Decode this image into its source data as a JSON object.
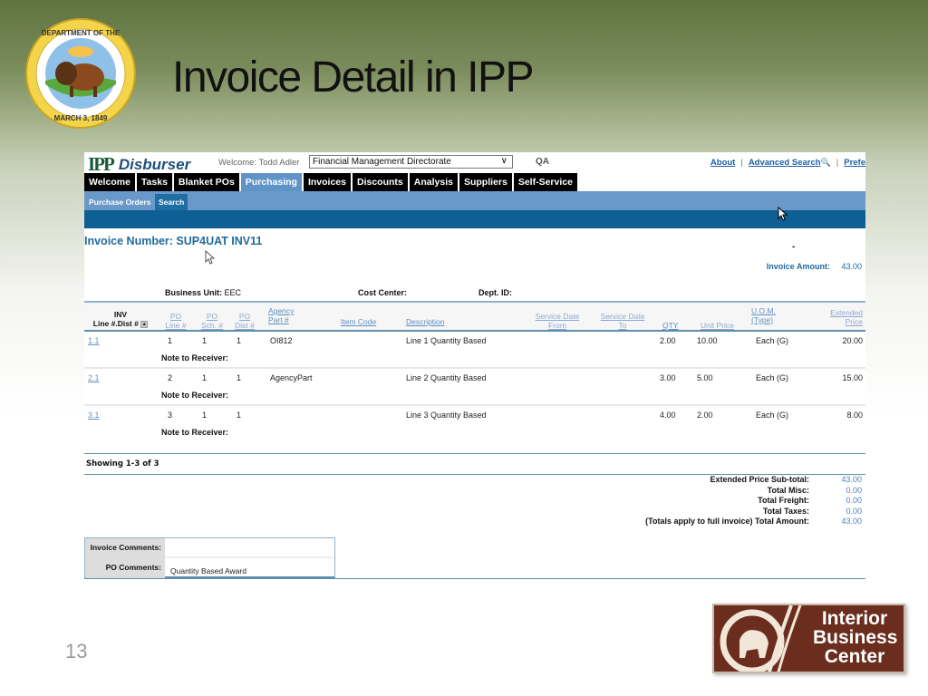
{
  "slide": {
    "title": "Invoice Detail in IPP",
    "page_number": "13",
    "seal_alt": "U.S. Department of the Interior seal — March 3, 1849",
    "logo_lines": [
      "Interior",
      "Business",
      "Center"
    ]
  },
  "app": {
    "brand_ipp": "IPP",
    "brand_name": "Disburser",
    "welcome": "Welcome: Todd Adler",
    "org_select": {
      "value": "Financial Management Directorate"
    },
    "environment": "QA",
    "top_links": [
      {
        "label": "About"
      },
      {
        "label": "Advanced Search"
      },
      {
        "label": "Prefe"
      }
    ],
    "nav_tabs": [
      {
        "label": "Welcome",
        "active": false
      },
      {
        "label": "Tasks",
        "active": false
      },
      {
        "label": "Blanket POs",
        "active": false
      },
      {
        "label": "Purchasing",
        "active": true
      },
      {
        "label": "Invoices",
        "active": false
      },
      {
        "label": "Discounts",
        "active": false
      },
      {
        "label": "Analysis",
        "active": false
      },
      {
        "label": "Suppliers",
        "active": false
      },
      {
        "label": "Self-Service",
        "active": false
      }
    ],
    "sub_tabs": [
      {
        "label": "Purchase Orders",
        "active": false
      },
      {
        "label": "Search",
        "active": true
      }
    ]
  },
  "invoice": {
    "title": "Invoice Number: SUP4UAT INV11",
    "dash": "-",
    "amount_label": "Invoice Amount:",
    "amount_value": "43.00",
    "business_unit_label": "Business Unit:",
    "business_unit_value": "EEC",
    "cost_center_label": "Cost Center:",
    "cost_center_value": "",
    "dept_id_label": "Dept. ID:",
    "dept_id_value": ""
  },
  "table": {
    "headers": {
      "inv_line": [
        "INV",
        "Line #.Dist #"
      ],
      "po_line": [
        "PO",
        "Line #"
      ],
      "po_sch": [
        "PO",
        "Sch. #"
      ],
      "po_dist": [
        "PO",
        "Dist #"
      ],
      "agency_part": [
        "Agency",
        "Part #"
      ],
      "item_code": "Item Code",
      "description": "Description",
      "service_from": [
        "Service Date",
        "From"
      ],
      "service_to": [
        "Service Date",
        "To"
      ],
      "qty": "QTY",
      "unit_price": "Unit Price",
      "uom": [
        "U.O.M.",
        "(Type)"
      ],
      "extended_price": [
        "Extended",
        "Price"
      ]
    },
    "note_label": "Note to Receiver:",
    "rows": [
      {
        "inv_line": "1.1",
        "po_line": "1",
        "po_sch": "1",
        "po_dist": "1",
        "agency_part": "OI812",
        "item_code": "",
        "description": "Line 1 Quantity Based",
        "service_from": "",
        "service_to": "",
        "qty": "2.00",
        "unit_price": "10.00",
        "uom": "Each (G)",
        "extended_price": "20.00",
        "note": ""
      },
      {
        "inv_line": "2.1",
        "po_line": "2",
        "po_sch": "1",
        "po_dist": "1",
        "agency_part": "AgencyPart",
        "item_code": "",
        "description": "Line 2 Quantity Based",
        "service_from": "",
        "service_to": "",
        "qty": "3.00",
        "unit_price": "5.00",
        "uom": "Each (G)",
        "extended_price": "15.00",
        "note": ""
      },
      {
        "inv_line": "3.1",
        "po_line": "3",
        "po_sch": "1",
        "po_dist": "1",
        "agency_part": "",
        "item_code": "",
        "description": "Line 3 Quantity Based",
        "service_from": "",
        "service_to": "",
        "qty": "4.00",
        "unit_price": "2.00",
        "uom": "Each (G)",
        "extended_price": "8.00",
        "note": ""
      }
    ],
    "showing": "Showing 1-3 of 3"
  },
  "totals": [
    {
      "label": "Extended Price Sub-total:",
      "value": "43.00"
    },
    {
      "label": "Total Misc:",
      "value": "0.00"
    },
    {
      "label": "Total Freight:",
      "value": "0.00"
    },
    {
      "label": "Total Taxes:",
      "value": "0.00"
    },
    {
      "label": "(Totals apply to full invoice) Total Amount:",
      "value": "43.00"
    }
  ],
  "comments": {
    "invoice_label": "Invoice Comments:",
    "invoice_value": "",
    "po_label": "PO Comments:",
    "po_value": "Quantity Based Award"
  }
}
